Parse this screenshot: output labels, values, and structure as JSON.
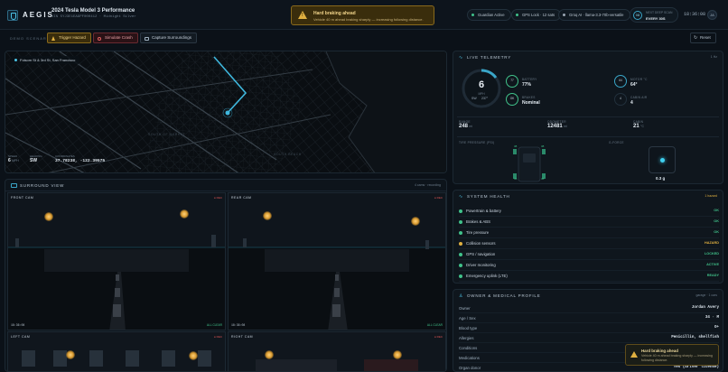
{
  "header": {
    "brand": "AEGIS",
    "vehicle_title": "2024 Tesla Model 3 Performance",
    "vehicle_sub": "VIN 5YJ3E1EA9PF000412 · Midnight Silver",
    "alert": {
      "title": "Hard braking ahead",
      "message": "Vehicle 40 m ahead braking sharply — increasing following distance."
    },
    "status_pills": [
      {
        "label": "Guardian Active",
        "color": "#40c28a"
      },
      {
        "label": "GPS Lock · 12 sats",
        "color": "#40c28a"
      },
      {
        "label": "Groq AI · llama-3.3-70b-versatile",
        "color": "#9aa6b2"
      }
    ],
    "sleep": {
      "ring": "08",
      "label": "NEXT DEEP SCAN",
      "value": "EVERY 30S"
    },
    "clock": "18:36:08",
    "avatar": "JA"
  },
  "demo": {
    "label": "DEMO SCENARIOS",
    "buttons": [
      "Trigger Hazard",
      "Simulate Crash",
      "Capture Surroundings"
    ],
    "reset": "Reset"
  },
  "map": {
    "location": "Folsom St & 3rd St, San Francisco",
    "labels": [
      "SOUTH OF MARKET",
      "SOUTH BEACH"
    ],
    "stats": [
      {
        "key": "SPEED",
        "value": "6",
        "unit": "MPH"
      },
      {
        "key": "HEADING",
        "value": "SW",
        "unit": ""
      },
      {
        "key": "COORDINATES",
        "value": "37.78238, -122.39575",
        "unit": ""
      }
    ]
  },
  "surround": {
    "title": "SURROUND VIEW",
    "right": "4 cams · recording",
    "cameras": [
      {
        "name": "FRONT CAM",
        "rec": "REC",
        "time": "18:36:08",
        "status": "ALL CLEAR"
      },
      {
        "name": "REAR CAM",
        "rec": "REC",
        "time": "18:36:08",
        "status": "ALL CLEAR"
      },
      {
        "name": "LEFT CAM",
        "rec": "REC"
      },
      {
        "name": "RIGHT CAM",
        "rec": "REC"
      }
    ]
  },
  "telemetry": {
    "title": "LIVE TELEMETRY",
    "right": "1 Hz",
    "speed": {
      "value": "6",
      "unit": "MPH",
      "gear": "SW",
      "dir": "237°"
    },
    "battery": {
      "label": "BATTERY",
      "value": "77%",
      "ring": "77",
      "fraction": 0.77
    },
    "brakes": {
      "label": "BRAKES",
      "value": "Nominal",
      "ring": "OK"
    },
    "motor_temp": {
      "label": "MOTOR °C",
      "value": "64°",
      "ring": "64"
    },
    "cabin_air": {
      "label": "CABIN AIR",
      "value": "4",
      "ring": "4"
    },
    "metrics": [
      {
        "key": "RANGE",
        "value": "248",
        "unit": "mi"
      },
      {
        "key": "ODOMETER",
        "value": "12481",
        "unit": "mi"
      },
      {
        "key": "CABIN",
        "value": "21",
        "unit": "°C"
      }
    ],
    "tire_title": "TIRE PRESSURE (PSI)",
    "tires": [
      "38",
      "38",
      "38",
      "38"
    ],
    "gforce_title": "G-FORCE",
    "gforce_value": "0.3 g"
  },
  "health": {
    "title": "SYSTEM HEALTH",
    "right": "1 hazard",
    "items": [
      {
        "name": "Powertrain & battery",
        "status": "OK",
        "color": "#40c28a"
      },
      {
        "name": "Brakes & ABS",
        "status": "OK",
        "color": "#40c28a"
      },
      {
        "name": "Tire pressure",
        "status": "OK",
        "color": "#40c28a"
      },
      {
        "name": "Collision sensors",
        "status": "HAZARD",
        "color": "#e0b040"
      },
      {
        "name": "GPS / navigation",
        "status": "LOCKED",
        "color": "#40c28a"
      },
      {
        "name": "Driver monitoring",
        "status": "ACTIVE",
        "color": "#40c28a"
      },
      {
        "name": "Emergency uplink (LTE)",
        "status": "READY",
        "color": "#40c28a"
      }
    ]
  },
  "owner": {
    "title": "OWNER & MEDICAL PROFILE",
    "right": "garage · 1 cars",
    "rows": [
      {
        "key": "Owner",
        "value": "Jordan Avery"
      },
      {
        "key": "Age / Sex",
        "value": "34 · M"
      },
      {
        "key": "Blood type",
        "value": "O+"
      },
      {
        "key": "Allergies",
        "value": "Penicillin, shellfish"
      },
      {
        "key": "Conditions",
        "value": "Asth"
      },
      {
        "key": "Medications",
        "value": "Al"
      },
      {
        "key": "Organ donor",
        "value": "Yes (driver license)"
      }
    ]
  },
  "toast": {
    "title": "Hard braking ahead",
    "message": "Vehicle 40 m ahead braking sharply — increasing following distance."
  }
}
